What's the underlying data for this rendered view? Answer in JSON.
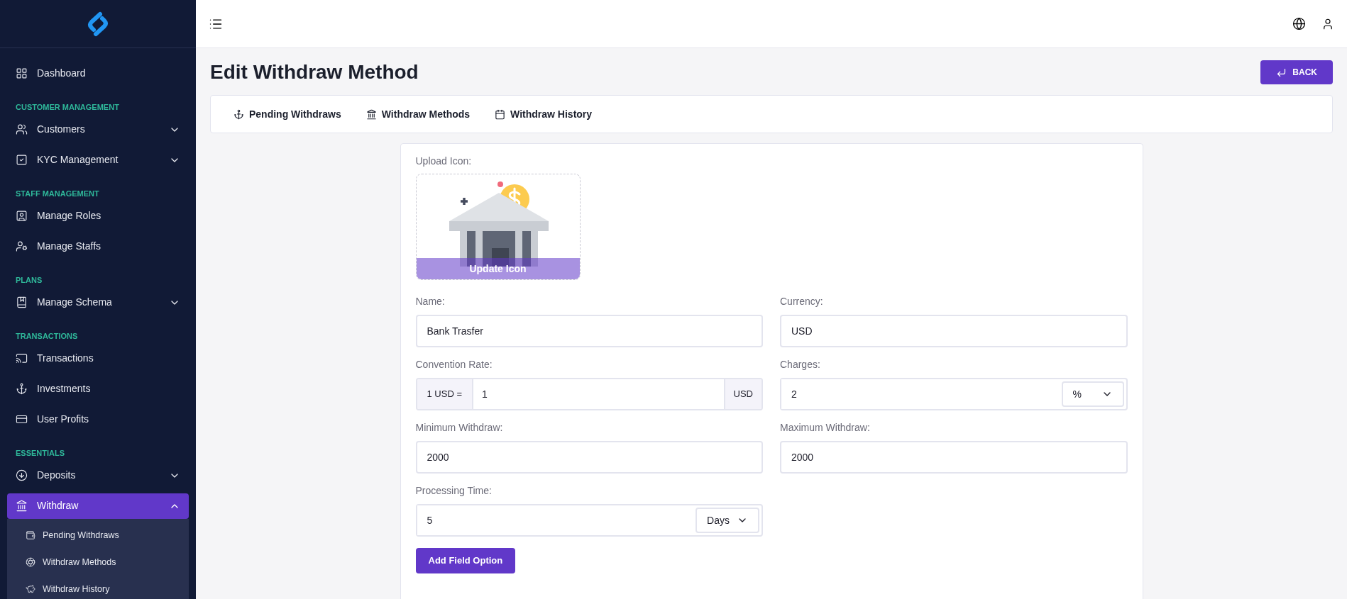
{
  "sidebar": {
    "items": [
      {
        "kind": "link",
        "label": "Dashboard",
        "selected": false
      },
      {
        "kind": "heading",
        "label": "CUSTOMER MANAGEMENT"
      },
      {
        "kind": "link",
        "label": "Customers",
        "selected": false,
        "expanded": false
      },
      {
        "kind": "link",
        "label": "KYC Management",
        "selected": false,
        "expanded": false
      },
      {
        "kind": "heading",
        "label": "STAFF MANAGEMENT"
      },
      {
        "kind": "link",
        "label": "Manage Roles",
        "selected": false
      },
      {
        "kind": "link",
        "label": "Manage Staffs",
        "selected": false
      },
      {
        "kind": "heading",
        "label": "PLANS"
      },
      {
        "kind": "link",
        "label": "Manage Schema",
        "selected": false,
        "expanded": false
      },
      {
        "kind": "heading",
        "label": "TRANSACTIONS"
      },
      {
        "kind": "link",
        "label": "Transactions",
        "selected": false
      },
      {
        "kind": "link",
        "label": "Investments",
        "selected": false
      },
      {
        "kind": "link",
        "label": "User Profits",
        "selected": false
      },
      {
        "kind": "heading",
        "label": "ESSENTIALS"
      },
      {
        "kind": "link",
        "label": "Deposits",
        "selected": false,
        "expanded": false
      },
      {
        "kind": "link",
        "label": "Withdraw",
        "selected": true,
        "expanded": true,
        "children": [
          {
            "label": "Pending Withdraws"
          },
          {
            "label": "Withdraw Methods"
          },
          {
            "label": "Withdraw History"
          }
        ]
      }
    ]
  },
  "page": {
    "title": "Edit Withdraw Method",
    "back_button": "BACK"
  },
  "tabs": [
    {
      "label": "Pending Withdraws"
    },
    {
      "label": "Withdraw Methods"
    },
    {
      "label": "Withdraw History"
    }
  ],
  "form": {
    "upload": {
      "label": "Upload Icon:",
      "overlay": "Update Icon"
    },
    "fields": [
      {
        "kind": "text",
        "label": "Name:",
        "value": "Bank Trasfer"
      },
      {
        "kind": "text",
        "label": "Currency:",
        "value": "USD"
      },
      {
        "kind": "prefix_suffix",
        "label": "Convention Rate:",
        "prefix": "1 USD =",
        "value": "1",
        "suffix": "USD"
      },
      {
        "kind": "select_suffix",
        "label": "Charges:",
        "value": "2",
        "unit": "%"
      },
      {
        "kind": "text",
        "label": "Minimum Withdraw:",
        "value": "2000"
      },
      {
        "kind": "text",
        "label": "Maximum Withdraw:",
        "value": "2000"
      },
      {
        "kind": "select_suffix",
        "label": "Processing Time:",
        "value": "5",
        "unit": "Days"
      }
    ],
    "add_button": "Add Field Option"
  }
}
